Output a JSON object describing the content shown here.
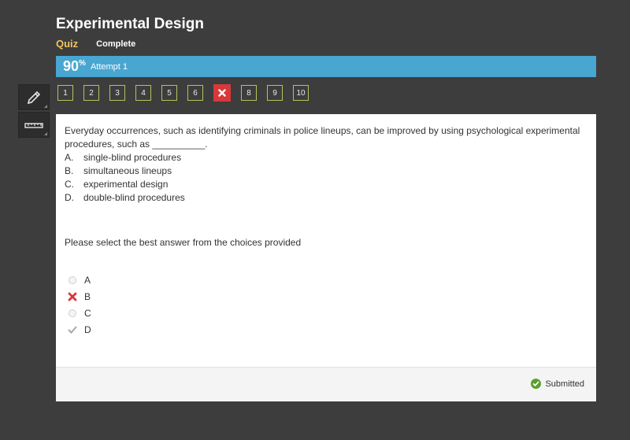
{
  "header": {
    "title": "Experimental Design",
    "quiz_label": "Quiz",
    "status_label": "Complete"
  },
  "score_bar": {
    "score": "90",
    "percent_sign": "%",
    "attempt": "Attempt 1",
    "color": "#48a6d1"
  },
  "tools": [
    "pencil-icon",
    "ruler-icon"
  ],
  "question_nav": [
    {
      "label": "1",
      "state": "correct"
    },
    {
      "label": "2",
      "state": "correct"
    },
    {
      "label": "3",
      "state": "correct"
    },
    {
      "label": "4",
      "state": "correct"
    },
    {
      "label": "5",
      "state": "correct"
    },
    {
      "label": "6",
      "state": "correct"
    },
    {
      "label": "",
      "state": "wrong"
    },
    {
      "label": "8",
      "state": "correct"
    },
    {
      "label": "9",
      "state": "correct"
    },
    {
      "label": "10",
      "state": "correct"
    }
  ],
  "question": {
    "text": "Everyday occurrences, such as identifying criminals in police lineups, can be improved by using psychological experimental procedures, such as __________.",
    "choices": [
      {
        "letter": "A.",
        "text": "single-blind procedures"
      },
      {
        "letter": "B.",
        "text": "simultaneous lineups"
      },
      {
        "letter": "C.",
        "text": "experimental design"
      },
      {
        "letter": "D.",
        "text": "double-blind procedures"
      }
    ],
    "instruction": "Please select the best answer from the choices provided"
  },
  "answers": [
    {
      "label": "A",
      "mark": "radio"
    },
    {
      "label": "B",
      "mark": "wrong"
    },
    {
      "label": "C",
      "mark": "radio"
    },
    {
      "label": "D",
      "mark": "check"
    }
  ],
  "footer": {
    "status": "Submitted",
    "status_color": "#5aa02c"
  },
  "colors": {
    "wrong": "#d9383a",
    "nav_border": "#b8c25a",
    "accent_gold": "#f2c45a"
  }
}
